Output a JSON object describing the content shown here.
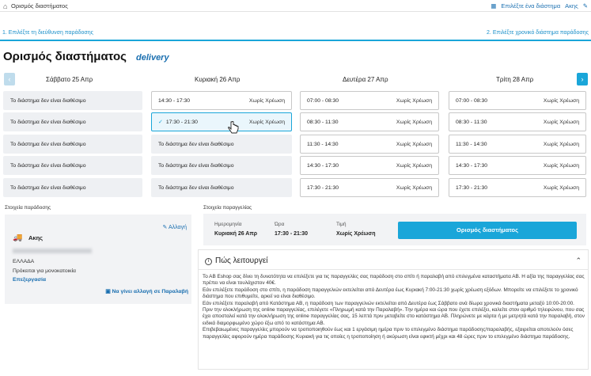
{
  "topbar": {
    "breadcrumb": "Ορισμός διαστήματος",
    "pick_slot": "Επιλέξτε ένα διάστημα",
    "cancel": "Ακης"
  },
  "steps": {
    "step1": "1. Επιλέξτε τη διεύθυνση παράδοσης",
    "step2": "2. Επιλέξτε χρονικό διάστημα παράδοσης"
  },
  "page": {
    "title": "Ορισμός διαστήματος",
    "delivery_label": "delivery"
  },
  "days": [
    {
      "label": "Σάββατο 25 Απρ",
      "slots": [
        {
          "time": "Το διάστημα δεν είναι διαθέσιμο",
          "charge": "",
          "available": false
        },
        {
          "time": "Το διάστημα δεν είναι διαθέσιμο",
          "charge": "",
          "available": false
        },
        {
          "time": "Το διάστημα δεν είναι διαθέσιμο",
          "charge": "",
          "available": false
        },
        {
          "time": "Το διάστημα δεν είναι διαθέσιμο",
          "charge": "",
          "available": false
        },
        {
          "time": "Το διάστημα δεν είναι διαθέσιμο",
          "charge": "",
          "available": false
        }
      ]
    },
    {
      "label": "Κυριακή 26 Απρ",
      "slots": [
        {
          "time": "14:30 - 17:30",
          "charge": "Χωρίς Χρέωση",
          "available": true
        },
        {
          "time": "17:30 - 21:30",
          "charge": "Χωρίς Χρέωση",
          "available": true,
          "selected": true
        },
        {
          "time": "Το διάστημα δεν είναι διαθέσιμο",
          "charge": "",
          "available": false
        },
        {
          "time": "Το διάστημα δεν είναι διαθέσιμο",
          "charge": "",
          "available": false
        },
        {
          "time": "Το διάστημα δεν είναι διαθέσιμο",
          "charge": "",
          "available": false
        }
      ]
    },
    {
      "label": "Δευτέρα 27 Απρ",
      "slots": [
        {
          "time": "07:00 - 08:30",
          "charge": "Χωρίς Χρέωση",
          "available": true
        },
        {
          "time": "08:30 - 11:30",
          "charge": "Χωρίς Χρέωση",
          "available": true
        },
        {
          "time": "11:30 - 14:30",
          "charge": "Χωρίς Χρέωση",
          "available": true
        },
        {
          "time": "14:30 - 17:30",
          "charge": "Χωρίς Χρέωση",
          "available": true
        },
        {
          "time": "17:30 - 21:30",
          "charge": "Χωρίς Χρέωση",
          "available": true
        }
      ]
    },
    {
      "label": "Τρίτη 28 Απρ",
      "slots": [
        {
          "time": "07:00 - 08:30",
          "charge": "Χωρίς Χρέωση",
          "available": true
        },
        {
          "time": "08:30 - 11:30",
          "charge": "Χωρίς Χρέωση",
          "available": true
        },
        {
          "time": "11:30 - 14:30",
          "charge": "Χωρίς Χρέωση",
          "available": true
        },
        {
          "time": "14:30 - 17:30",
          "charge": "Χωρίς Χρέωση",
          "available": true
        },
        {
          "time": "17:30 - 21:30",
          "charge": "Χωρίς Χρέωση",
          "available": true
        }
      ]
    }
  ],
  "delivery_info": {
    "label": "Στοιχεία παράδοσης",
    "change": "Αλλαγή",
    "name": "Ακης",
    "country": "ΕΛΛΑΔΑ",
    "house_type": "Πρόκειται για μονοκατοικία",
    "edit": "Επεξεργασία",
    "pickup_change": "Να γίνει αλλαγή σε Παραλαβή"
  },
  "order_info": {
    "label": "Στοιχεία παραγγελίας",
    "date_label": "Ημερομηνία",
    "date_value": "Κυριακή 26 Απρ",
    "time_label": "Ώρα",
    "time_value": "17:30 - 21:30",
    "price_label": "Τιμή",
    "price_value": "Χωρίς Χρέωση",
    "button": "Ορισμός διαστήματος"
  },
  "how_it_works": {
    "title": "Πώς λειτουργεί",
    "paragraphs": [
      "Το ΑΒ Eshop σας δίνει τη δυνατότητα να επιλέξετε για τις παραγγελίες σας παράδοση στο σπίτι ή παραλαβή από επιλεγμένα καταστήματα ΑΒ. Η αξία της παραγγελίας σας πρέπει να είναι τουλάχιστον 40€.",
      "Εάν επιλέξετε παράδοση στο σπίτι, η παράδοση παραγγελιών εκτελείται από Δευτέρα έως Κυριακή 7:00-21:30 χωρίς χρέωση εξόδων. Μπορείτε να επιλέξετε το χρονικό διάστημα που επιθυμείτε, αρκεί να είναι διαθέσιμο.",
      "Εάν επιλέξετε παραλαβή από Κατάστημα ΑΒ, η παράδοση των παραγγελιών εκτελείται από Δευτέρα έως Σάββατο ανά δίωρα χρονικά διαστήματα μεταξύ 10:00-20:00. Πριν την ολοκλήρωση της online παραγγελίας, επιλέγετε «Πληρωμή κατά την Παραλαβή». Την ημέρα και ώρα που έχετε επιλέξει, καλείτε στον αριθμό τηλεφώνου, που σας έχει αποσταλεί κατά την ολοκλήρωση της online παραγγελίας σας, 15 λεπτά πριν μεταβείτε στο κατάστημα ΑΒ. Πληρώνετε με κάρτα ή με μετρητά κατά την παραλαβή, στον ειδικά διαμορφωμένο χώρο έξω από το κατάστημα ΑΒ.",
      "Επιβεβαιωμένες παραγγελίες μπορούν να τροποποιηθούν έως και 1 εργάσιμη ημέρα πριν το επιλεγμένο διάστημα παράδοσης/παραλαβής, εξαιρείται αποτελούν όσες παραγγελίες αφορούν ημέρα παράδοσης Κυριακή για τις οποίες η τροποποίηση ή ακύρωση είναι εφικτή μέχρι και 48 ώρες πριν το επιλεγμένο διάστημα παράδοσης."
    ]
  },
  "colors": {
    "accent": "#1aa6d9",
    "link": "#1a6fb0",
    "unavailable_bg": "#eef0f3"
  }
}
